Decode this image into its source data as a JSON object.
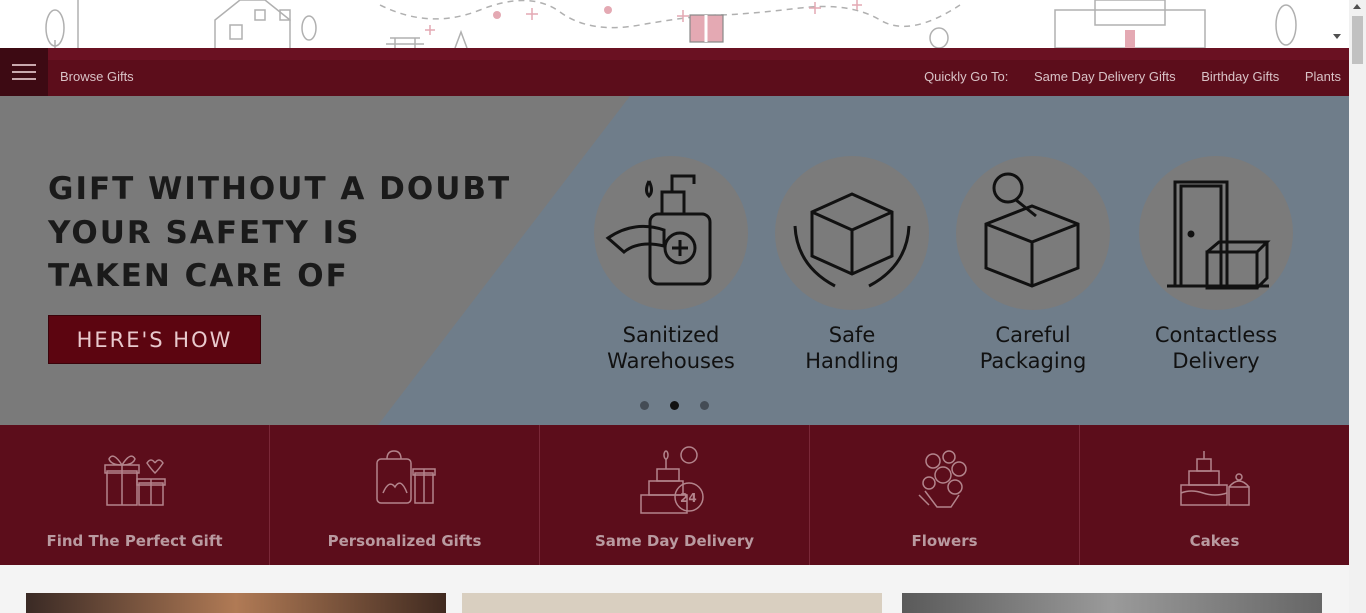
{
  "nav": {
    "browse_label": "Browse Gifts",
    "quick_label": "Quickly Go To:",
    "links": [
      "Same Day Delivery Gifts",
      "Birthday Gifts",
      "Plants"
    ]
  },
  "hero": {
    "headline_lines": [
      "GIFT WITHOUT A DOUBT",
      "YOUR SAFETY IS",
      "TAKEN CARE OF"
    ],
    "button_label": "HERE'S HOW",
    "features": [
      {
        "line1": "Sanitized",
        "line2": "Warehouses",
        "icon": "sanitizer-icon"
      },
      {
        "line1": "Safe",
        "line2": "Handling",
        "icon": "box-hands-icon"
      },
      {
        "line1": "Careful",
        "line2": "Packaging",
        "icon": "tape-box-icon"
      },
      {
        "line1": "Contactless",
        "line2": "Delivery",
        "icon": "door-box-icon"
      }
    ],
    "slider": {
      "total": 3,
      "active": 2
    }
  },
  "categories": [
    {
      "label": "Find The Perfect Gift",
      "icon": "gift-boxes-icon"
    },
    {
      "label": "Personalized Gifts",
      "icon": "personalized-bag-icon"
    },
    {
      "label": "Same Day Delivery",
      "icon": "cake-24-icon"
    },
    {
      "label": "Flowers",
      "icon": "flowers-icon"
    },
    {
      "label": "Cakes",
      "icon": "cake-icon"
    }
  ],
  "colors": {
    "brand_dark": "#5c0d1b",
    "hero_bg": "#6f7d8a",
    "button_bg": "#5c0510"
  }
}
